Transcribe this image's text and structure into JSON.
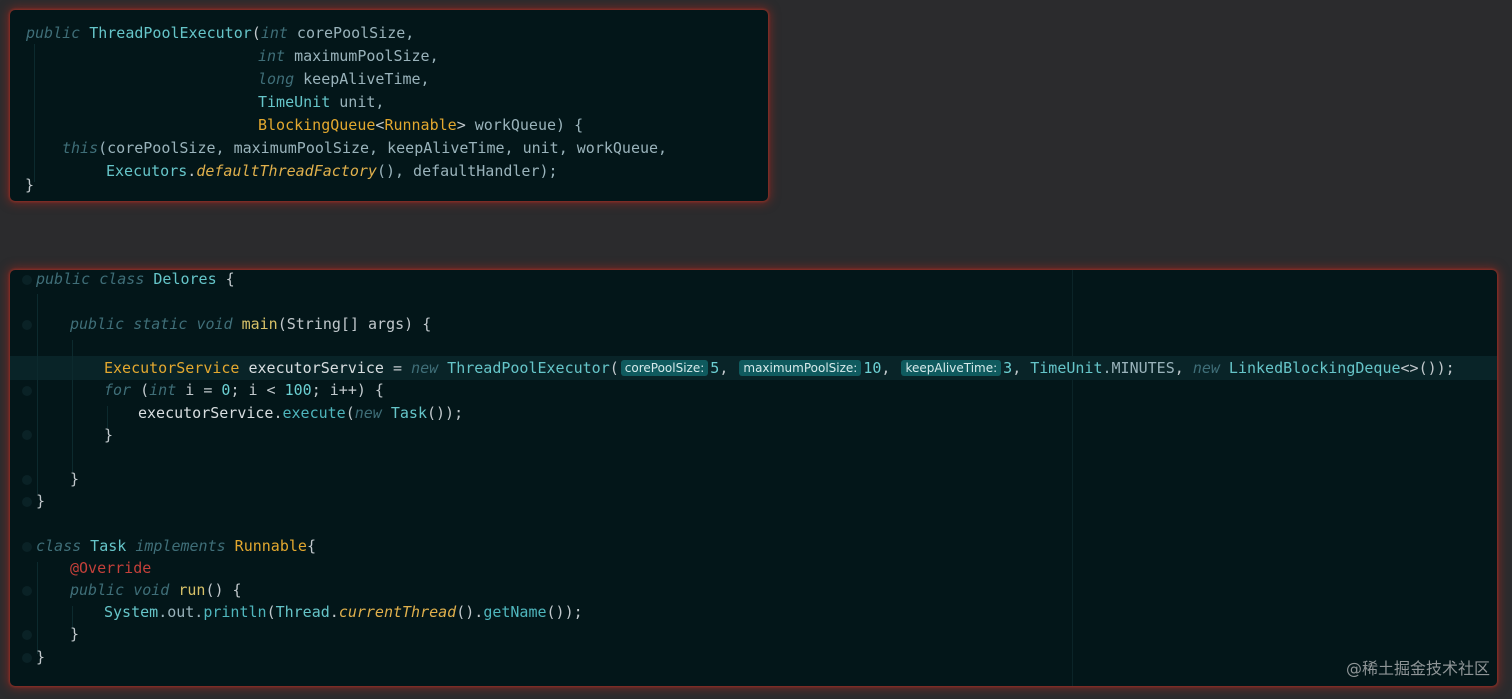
{
  "top_snippet": {
    "l1": {
      "t1": "public",
      "t2": " ThreadPoolExecutor",
      "t3": "(",
      "t4": "int",
      "t5": " corePoolSize,"
    },
    "l2": {
      "t1": "int",
      "t2": " maximumPoolSize,"
    },
    "l3": {
      "t1": "long",
      "t2": " keepAliveTime,"
    },
    "l4": {
      "t1": "TimeUnit",
      "t2": " unit,"
    },
    "l5": {
      "t1": "BlockingQueue",
      "t2": "<",
      "t3": "Runnable",
      "t4": ">",
      "t5": " workQueue) {"
    },
    "l6": {
      "t1": "this",
      "t2": "(corePoolSize, maximumPoolSize, keepAliveTime, unit, workQueue,"
    },
    "l7": {
      "t1": "Executors",
      "t2": ".",
      "t3": "defaultThreadFactory",
      "t4": "(), defaultHandler);"
    },
    "l8": {
      "t1": "}"
    }
  },
  "bottom_snippet": {
    "l1": {
      "t1": "public",
      "t2": "class",
      "t3": "Delores",
      "t4": " {"
    },
    "l2": {
      "t1": "public",
      "t2": "static",
      "t3": "void",
      "t4": "main",
      "t5": "(String[] args) {"
    },
    "l3": {
      "t1": "ExecutorService",
      "t2": " executorService",
      "t3": " = ",
      "t4": "new",
      "t5": " ThreadPoolExecutor",
      "t6": "(",
      "hint1": "corePoolSize:",
      "v1": "5",
      "sep1": ", ",
      "hint2": "maximumPoolSize:",
      "v2": "10",
      "sep2": ", ",
      "hint3": "keepAliveTime:",
      "v3": "3",
      "sep3": ", ",
      "t7": "TimeUnit",
      "t8": ".MINUTES",
      "t9": ", ",
      "t10": "new",
      "t11": " LinkedBlockingDeque",
      "t12": "<>());"
    },
    "l4": {
      "t1": "for",
      "t2": " (",
      "t3": "int",
      "t4": " i = ",
      "t5": "0",
      "t6": "; i < ",
      "t7": "100",
      "t8": "; i++) {"
    },
    "l5": {
      "t1": "executorService",
      "t2": ".",
      "t3": "execute",
      "t4": "(",
      "t5": "new",
      "t6": " Task",
      "t7": "());"
    },
    "l6": {
      "t1": "}"
    },
    "l7": {
      "t1": "}"
    },
    "l8": {
      "t1": "}"
    },
    "l9": {
      "t1": "class",
      "t2": " Task",
      "t3": " implements",
      "t4": " Runnable",
      "t5": "{"
    },
    "l10": {
      "t1": "@Override"
    },
    "l11": {
      "t1": "public",
      "t2": "void",
      "t3": "run",
      "t4": "() {"
    },
    "l12": {
      "t1": "System",
      "t2": ".out.",
      "t3": "println",
      "t4": "(",
      "t5": "Thread",
      "t6": ".",
      "t7": "currentThread",
      "t8": "().",
      "t9": "getName",
      "t10": "());"
    },
    "l13": {
      "t1": "}"
    },
    "l14": {
      "t1": "}"
    }
  },
  "watermark": "@稀土掘金技术社区"
}
